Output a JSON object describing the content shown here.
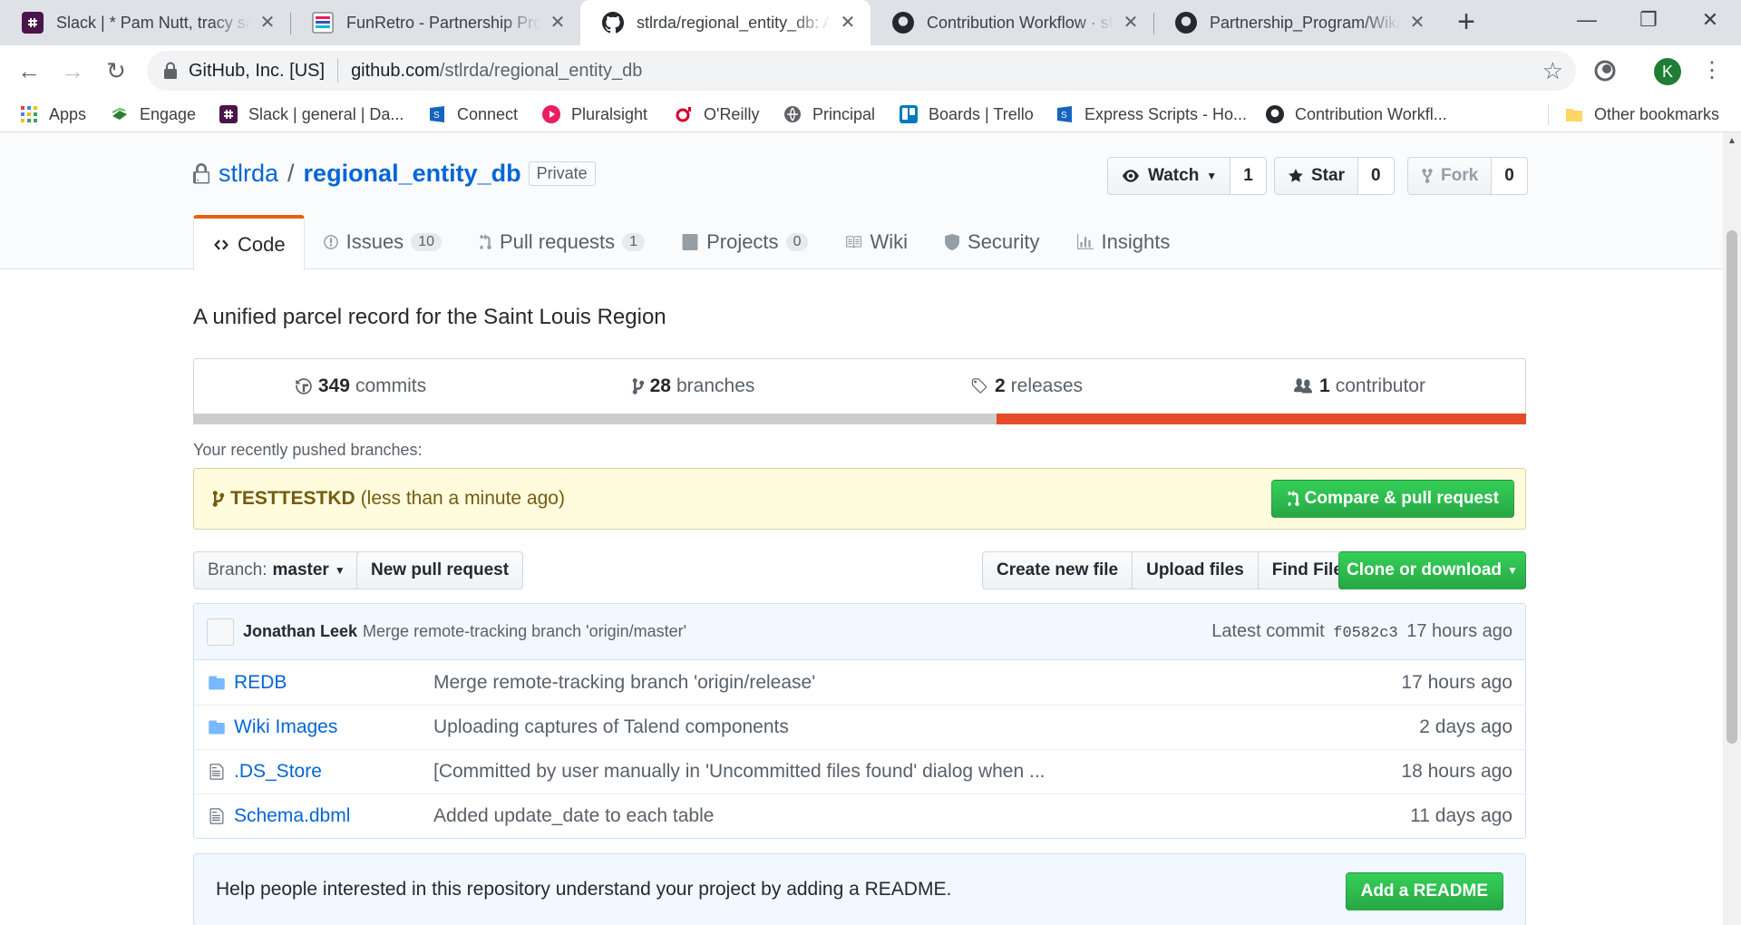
{
  "browser": {
    "tabs": [
      {
        "title": "Slack | * Pam Nutt, tracy sap",
        "icon": "slack-icon"
      },
      {
        "title": "FunRetro - Partnership Prog",
        "icon": "funretro-icon"
      },
      {
        "title": "stlrda/regional_entity_db: A",
        "icon": "github-icon"
      },
      {
        "title": "Contribution Workflow · stl",
        "icon": "github-icon"
      },
      {
        "title": "Partnership_Program/Wiki I",
        "icon": "github-icon"
      }
    ],
    "new_tab": "+",
    "site_identity": "GitHub, Inc. [US]",
    "url_host": "github.com",
    "url_path": "/stlrda/regional_entity_db",
    "profile_initial": "K",
    "bookmarks": [
      {
        "label": "Apps",
        "icon": "apps-grid-icon"
      },
      {
        "label": "Engage",
        "icon": "engage-icon"
      },
      {
        "label": "Slack | general | Da...",
        "icon": "slack-icon"
      },
      {
        "label": "Connect",
        "icon": "express-scripts-icon"
      },
      {
        "label": "Pluralsight",
        "icon": "pluralsight-icon"
      },
      {
        "label": "O'Reilly",
        "icon": "oreilly-icon"
      },
      {
        "label": "Principal",
        "icon": "principal-icon"
      },
      {
        "label": "Boards | Trello",
        "icon": "trello-icon"
      },
      {
        "label": "Express Scripts - Ho...",
        "icon": "express-scripts-icon"
      },
      {
        "label": "Contribution Workfl...",
        "icon": "github-icon"
      }
    ],
    "other_bookmarks": "Other bookmarks"
  },
  "repo": {
    "owner": "stlrda",
    "separator": "/",
    "name": "regional_entity_db",
    "visibility": "Private",
    "watch": {
      "label": "Watch",
      "count": "1"
    },
    "star": {
      "label": "Star",
      "count": "0"
    },
    "fork": {
      "label": "Fork",
      "count": "0"
    },
    "nav": [
      {
        "label": "Code",
        "counter": null,
        "icon": "code-icon"
      },
      {
        "label": "Issues",
        "counter": "10",
        "icon": "issue-icon"
      },
      {
        "label": "Pull requests",
        "counter": "1",
        "icon": "pull-request-icon"
      },
      {
        "label": "Projects",
        "counter": "0",
        "icon": "project-icon"
      },
      {
        "label": "Wiki",
        "counter": null,
        "icon": "book-icon"
      },
      {
        "label": "Security",
        "counter": null,
        "icon": "shield-icon"
      },
      {
        "label": "Insights",
        "counter": null,
        "icon": "graph-icon"
      }
    ],
    "description": "A unified parcel record for the Saint Louis Region",
    "summary": {
      "commits_num": "349",
      "commits_label": "commits",
      "branches_num": "28",
      "branches_label": "branches",
      "releases_num": "2",
      "releases_label": "releases",
      "contributors_num": "1",
      "contributors_label": "contributor"
    },
    "languages": [
      {
        "share": 0.603,
        "color": "#cccccc"
      },
      {
        "share": 0.397,
        "color": "#e34c26"
      }
    ],
    "recent": {
      "label": "Your recently pushed branches:",
      "branch": "TESTTESTKD",
      "when": "(less than a minute ago)",
      "compare_button": "Compare & pull request"
    },
    "file_nav": {
      "branch_prefix": "Branch:",
      "branch": "master",
      "new_pr": "New pull request",
      "create_file": "Create new file",
      "upload_files": "Upload files",
      "find_file": "Find File",
      "clone": "Clone or download"
    },
    "latest_commit": {
      "author": "Jonathan Leek",
      "message": "Merge remote-tracking branch 'origin/master'",
      "prefix": "Latest commit",
      "sha": "f0582c3",
      "age": "17 hours ago"
    },
    "files": [
      {
        "type": "folder",
        "name": "REDB",
        "message": "Merge remote-tracking branch 'origin/release'",
        "age": "17 hours ago"
      },
      {
        "type": "folder",
        "name": "Wiki Images",
        "message": "Uploading captures of Talend components",
        "age": "2 days ago"
      },
      {
        "type": "file",
        "name": ".DS_Store",
        "message": "[Committed by user manually in 'Uncommitted files found' dialog when ...",
        "age": "18 hours ago"
      },
      {
        "type": "file",
        "name": "Schema.dbml",
        "message": "Added update_date to each table",
        "age": "11 days ago"
      }
    ],
    "readme": {
      "text": "Help people interested in this repository understand your project by adding a README.",
      "button": "Add a README"
    }
  }
}
